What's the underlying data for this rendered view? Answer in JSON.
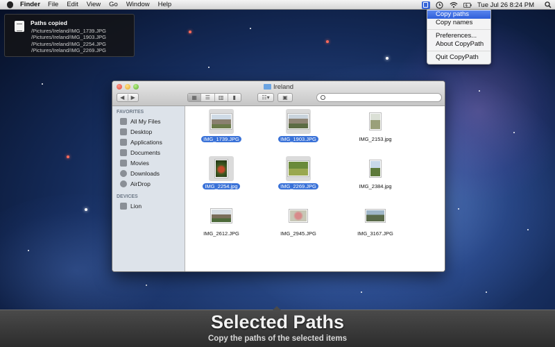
{
  "menubar": {
    "app_name": "Finder",
    "menus": [
      "File",
      "Edit",
      "View",
      "Go",
      "Window",
      "Help"
    ],
    "clock": "Tue Jul 26  8:24 PM",
    "extra_icons": [
      "copypath-icon",
      "time-machine-icon",
      "wifi-icon",
      "battery-icon"
    ]
  },
  "notification": {
    "title": "Paths copied",
    "paths": [
      "/Pictures/Ireland/IMG_1739.JPG",
      "/Pictures/Ireland/IMG_1903.JPG",
      "/Pictures/Ireland/IMG_2254.JPG",
      "/Pictures/Ireland/IMG_2269.JPG"
    ]
  },
  "dropdown": {
    "items": [
      "Copy paths",
      "Copy names",
      "Preferences...",
      "About CopyPath",
      "Quit CopyPath"
    ],
    "selected": "Copy paths"
  },
  "finder": {
    "title": "Ireland",
    "sidebar": {
      "favorites_header": "FAVORITES",
      "favorites": [
        "All My Files",
        "Desktop",
        "Applications",
        "Documents",
        "Movies",
        "Downloads",
        "AirDrop"
      ],
      "devices_header": "DEVICES",
      "devices": [
        "Lion"
      ]
    },
    "files": [
      {
        "name": "IMG_1739.JPG",
        "selected": true,
        "orientation": "landscape"
      },
      {
        "name": "IMG_1903.JPG",
        "selected": true,
        "orientation": "landscape"
      },
      {
        "name": "IMG_2153.jpg",
        "selected": false,
        "orientation": "portrait"
      },
      {
        "name": "IMG_2254.jpg",
        "selected": true,
        "orientation": "portrait"
      },
      {
        "name": "IMG_2269.JPG",
        "selected": true,
        "orientation": "landscape"
      },
      {
        "name": "IMG_2384.jpg",
        "selected": false,
        "orientation": "portrait"
      },
      {
        "name": "IMG_2612.JPG",
        "selected": false,
        "orientation": "landscape"
      },
      {
        "name": "IMG_2945.JPG",
        "selected": false,
        "orientation": "landscape"
      },
      {
        "name": "IMG_3167.JPG",
        "selected": false,
        "orientation": "landscape"
      }
    ]
  },
  "banner": {
    "headline": "Selected Paths",
    "subtitle": "Copy the paths of the selected items"
  },
  "colors": {
    "selection": "#3a72d8",
    "menu_highlight": "#2f5fda",
    "banner_bg": "#2c2c2c"
  }
}
